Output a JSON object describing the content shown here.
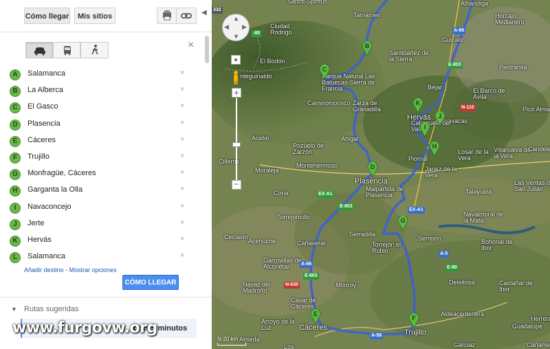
{
  "toolbar": {
    "directions_label": "Cómo llegar",
    "my_places_label": "Mis sitios"
  },
  "waypoints": [
    {
      "letter": "A",
      "name": "Salamanca"
    },
    {
      "letter": "B",
      "name": "La Alberca"
    },
    {
      "letter": "C",
      "name": "El Gasco"
    },
    {
      "letter": "D",
      "name": "Plasencia"
    },
    {
      "letter": "E",
      "name": "Cáceres"
    },
    {
      "letter": "F",
      "name": "Trujillo"
    },
    {
      "letter": "G",
      "name": "Monfragüe, Cáceres"
    },
    {
      "letter": "H",
      "name": "Garganta la Olla"
    },
    {
      "letter": "I",
      "name": "Navaconcejo"
    },
    {
      "letter": "J",
      "name": "Jerte"
    },
    {
      "letter": "K",
      "name": "Hervás"
    },
    {
      "letter": "L",
      "name": "Salamanca"
    }
  ],
  "remove_glyph": "×",
  "close_glyph": "×",
  "add_destination": "Añadir destino",
  "separator": "-",
  "show_options": "Mostrar opciones",
  "get_directions_button": "CÓMO LLEGAR",
  "suggested_routes": {
    "heading": "Rutas sugeridas",
    "route_time": "oras 5 minutos"
  },
  "watermark": "www.furgovw.org",
  "map": {
    "labels": [
      {
        "text": "Sancti-Spiritus"
      },
      {
        "text": "Alhandiga"
      },
      {
        "text": "Ciudad Rodrigo"
      },
      {
        "text": "Tamames"
      },
      {
        "text": "Horcajo Medianero"
      },
      {
        "text": "Guijuelo"
      },
      {
        "text": "El Bodón"
      },
      {
        "text": "Santibáñez de la Sierra"
      },
      {
        "text": "Piedrahita"
      },
      {
        "text": "nteguinaldo"
      },
      {
        "text": "Parque Natural Las Batuecas-Sierra de Francia"
      },
      {
        "text": "Béjar"
      },
      {
        "text": "El Barco de Ávila"
      },
      {
        "text": "Caminomorisco"
      },
      {
        "text": "Hervás"
      },
      {
        "text": "Pico Almanzor"
      },
      {
        "text": "Zarza de Granadilla"
      },
      {
        "text": "Tornavacas"
      },
      {
        "text": "Cabezuela del Valle"
      },
      {
        "text": "Acebo"
      },
      {
        "text": "Pozuelo de Zarzón"
      },
      {
        "text": "Ahigal"
      },
      {
        "text": "Piornal"
      },
      {
        "text": "Losar de la Vera"
      },
      {
        "text": "Villanueva de la Vera"
      },
      {
        "text": "Candele"
      },
      {
        "text": "Cilleros"
      },
      {
        "text": "Montehermoso"
      },
      {
        "text": "Jaraíz de la Vera"
      },
      {
        "text": "Moraleja"
      },
      {
        "text": "Plasencia"
      },
      {
        "text": "Talayuela"
      },
      {
        "text": "Las Ventas de San Julián"
      },
      {
        "text": "Coria"
      },
      {
        "text": "Malpartida de Plasencia"
      },
      {
        "text": "Torrejoncillo"
      },
      {
        "text": "Navalmoral de la Mata"
      },
      {
        "text": "Serradilla"
      },
      {
        "text": "Serrejón"
      },
      {
        "text": "Ceclavín"
      },
      {
        "text": "Acehuche"
      },
      {
        "text": "Cañaveral"
      },
      {
        "text": "Torrejón el Rubio"
      },
      {
        "text": "Bohonal de Ibor"
      },
      {
        "text": "Garrovillas de Alconétar"
      },
      {
        "text": "Navas del Madroño"
      },
      {
        "text": "Monroy"
      },
      {
        "text": "Deleitosa"
      },
      {
        "text": "Castañar de Ibor"
      },
      {
        "text": "Casar de Cáceres"
      },
      {
        "text": "Arroyo de la Luz"
      },
      {
        "text": "Aldeacentenera"
      },
      {
        "text": "Cáceres"
      },
      {
        "text": "Trujillo"
      },
      {
        "text": "Herrera del Duque"
      },
      {
        "text": "Guadalupe"
      },
      {
        "text": "Aliseda"
      },
      {
        "text": "Garciaz"
      },
      {
        "text": "Cañamero"
      },
      {
        "text": "Los"
      }
    ],
    "roads": [
      {
        "text": "A-66"
      },
      {
        "text": "E-803"
      },
      {
        "text": "N-110"
      },
      {
        "text": "EX-A1"
      },
      {
        "text": "E-803"
      },
      {
        "text": "A-66"
      },
      {
        "text": "EX-A1"
      },
      {
        "text": "A-5"
      },
      {
        "text": "E-90"
      },
      {
        "text": "N-630"
      },
      {
        "text": "E-803"
      },
      {
        "text": "A-58"
      },
      {
        "text": "332"
      },
      {
        "text": "-80"
      }
    ],
    "scale_label": "20 km",
    "scale_prefix": "N-"
  }
}
